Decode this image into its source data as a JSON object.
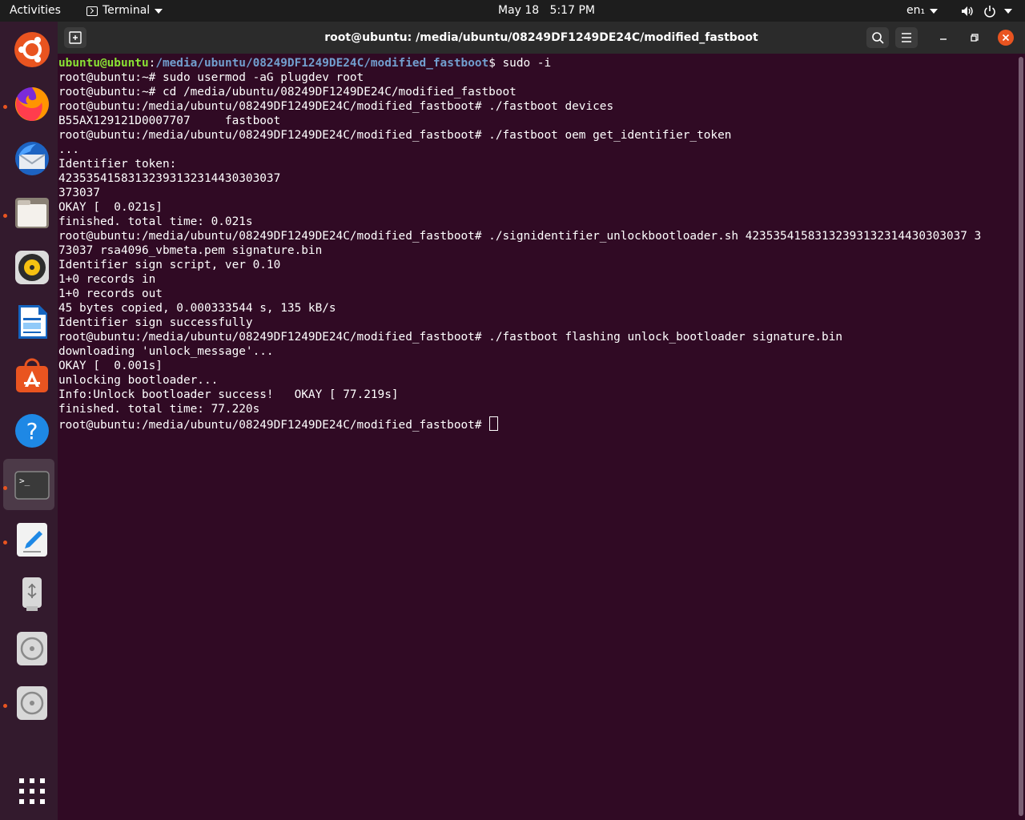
{
  "topbar": {
    "activities": "Activities",
    "app_name": "Terminal",
    "clock": "May 18   5:17 PM",
    "lang": "en₁"
  },
  "dock": {
    "items": [
      {
        "name": "ubuntu-logo-icon",
        "running": false
      },
      {
        "name": "firefox-icon",
        "running": true
      },
      {
        "name": "thunderbird-icon",
        "running": false
      },
      {
        "name": "files-icon",
        "running": true
      },
      {
        "name": "rhythmbox-icon",
        "running": false
      },
      {
        "name": "libreoffice-writer-icon",
        "running": false
      },
      {
        "name": "ubuntu-software-icon",
        "running": false
      },
      {
        "name": "help-icon",
        "running": false
      },
      {
        "name": "terminal-icon",
        "running": true
      },
      {
        "name": "text-editor-icon",
        "running": true
      },
      {
        "name": "usb-drive-icon",
        "running": false
      },
      {
        "name": "disc-drive-icon",
        "running": false
      },
      {
        "name": "disc-drive-icon",
        "running": true
      },
      {
        "name": "show-apps-icon",
        "running": false
      }
    ]
  },
  "window": {
    "title": "root@ubuntu: /media/ubuntu/08249DF1249DE24C/modified_fastboot"
  },
  "terminal": {
    "prompt_user": "ubuntu@ubuntu",
    "prompt_path": "/media/ubuntu/08249DF1249DE24C/modified_fastboot",
    "first_cmd": "$ sudo -i",
    "lines": [
      "root@ubuntu:~# sudo usermod -aG plugdev root",
      "root@ubuntu:~# cd /media/ubuntu/08249DF1249DE24C/modified_fastboot",
      "root@ubuntu:/media/ubuntu/08249DF1249DE24C/modified_fastboot# ./fastboot devices",
      "B55AX129121D0007707     fastboot",
      "root@ubuntu:/media/ubuntu/08249DF1249DE24C/modified_fastboot# ./fastboot oem get_identifier_token",
      "...",
      "Identifier token:",
      "42353541583132393132314430303037",
      "373037",
      "OKAY [  0.021s]",
      "finished. total time: 0.021s",
      "root@ubuntu:/media/ubuntu/08249DF1249DE24C/modified_fastboot# ./signidentifier_unlockbootloader.sh 42353541583132393132314430303037 3",
      "73037 rsa4096_vbmeta.pem signature.bin",
      "Identifier sign script, ver 0.10",
      "1+0 records in",
      "1+0 records out",
      "45 bytes copied, 0.000333544 s, 135 kB/s",
      "Identifier sign successfully",
      "root@ubuntu:/media/ubuntu/08249DF1249DE24C/modified_fastboot# ./fastboot flashing unlock_bootloader signature.bin",
      "downloading 'unlock_message'...",
      "OKAY [  0.001s]",
      "unlocking bootloader...",
      "Info:Unlock bootloader success!   OKAY [ 77.219s]",
      "finished. total time: 77.220s"
    ],
    "last_prompt": "root@ubuntu:/media/ubuntu/08249DF1249DE24C/modified_fastboot# "
  }
}
